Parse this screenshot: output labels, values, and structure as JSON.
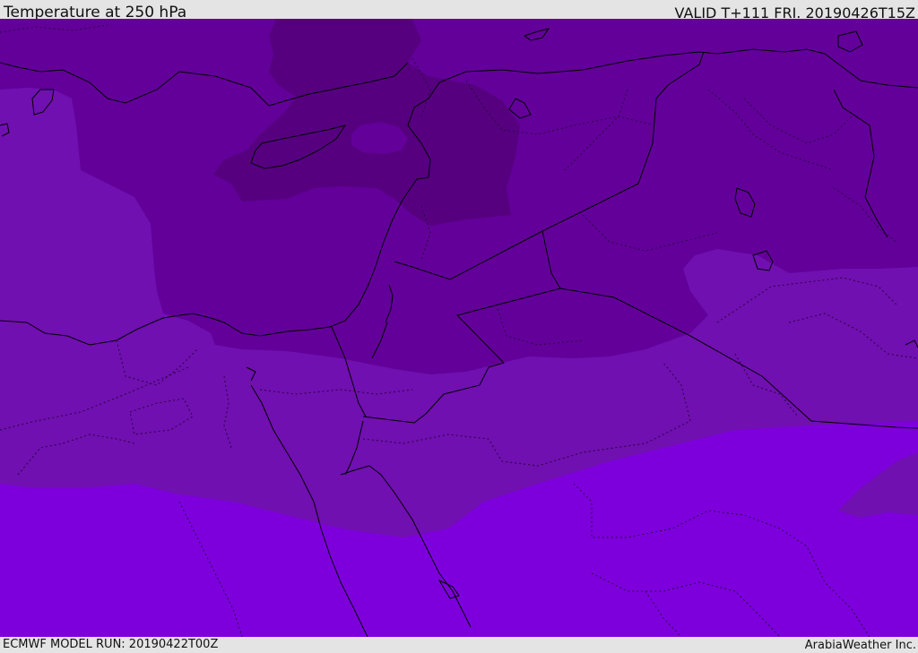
{
  "header": {
    "title": "Temperature at 250 hPa",
    "valid_time": "VALID T+111 FRI. 20190426T15Z"
  },
  "footer": {
    "model_run": "ECMWF MODEL RUN: 20190422T00Z",
    "credit": "ArabiaWeather Inc."
  },
  "colors": {
    "band_coldest": "#560080",
    "band_cold": "#63009a",
    "band_mid": "#7010b0",
    "band_warm": "#7d00dc",
    "coastline": "#000000",
    "border": "#000000",
    "province_border": "#2a0040",
    "ui_background": "#e4e4e4"
  }
}
